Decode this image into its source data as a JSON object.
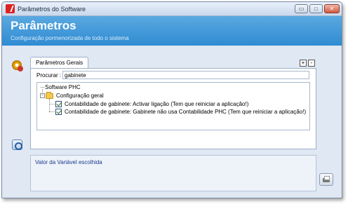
{
  "window": {
    "title": "Parâmetros do Software",
    "controls": {
      "minimize": "▭",
      "maximize": "□",
      "close": "✕"
    }
  },
  "header": {
    "title": "Parâmetros",
    "subtitle": "Configuração pormenorizada de todo o sistema"
  },
  "tabs": [
    {
      "label": "Parâmetros Gerais",
      "active": true
    }
  ],
  "tab_controls": {
    "expand": "+",
    "collapse": "-"
  },
  "search": {
    "label": "Procurar :",
    "value": "gabinete"
  },
  "tree": {
    "root": "Software PHC",
    "group": {
      "label": "Configuração geral",
      "expander": "-"
    },
    "items": [
      {
        "label": "Contabilidade de gabinete: Activar ligação (Tem que reiniciar a aplicação!)",
        "checked": true
      },
      {
        "label": "Contabilidade de gabinete: Gabinete não usa Contabilidade PHC (Tem que reiniciar a aplicação!)",
        "checked": true
      }
    ]
  },
  "detail": {
    "label": "Valor da Variável escolhida"
  },
  "icons": {
    "app": "phc-logo-icon",
    "settings": "gear-icon",
    "side_button": "power-icon",
    "print": "printer-icon",
    "folder": "folder-icon"
  },
  "colors": {
    "header_top": "#5aa9e0",
    "header_bottom": "#2f8bd2",
    "detail_text": "#1a3a8c",
    "window_bg": "#dfe8f3"
  }
}
